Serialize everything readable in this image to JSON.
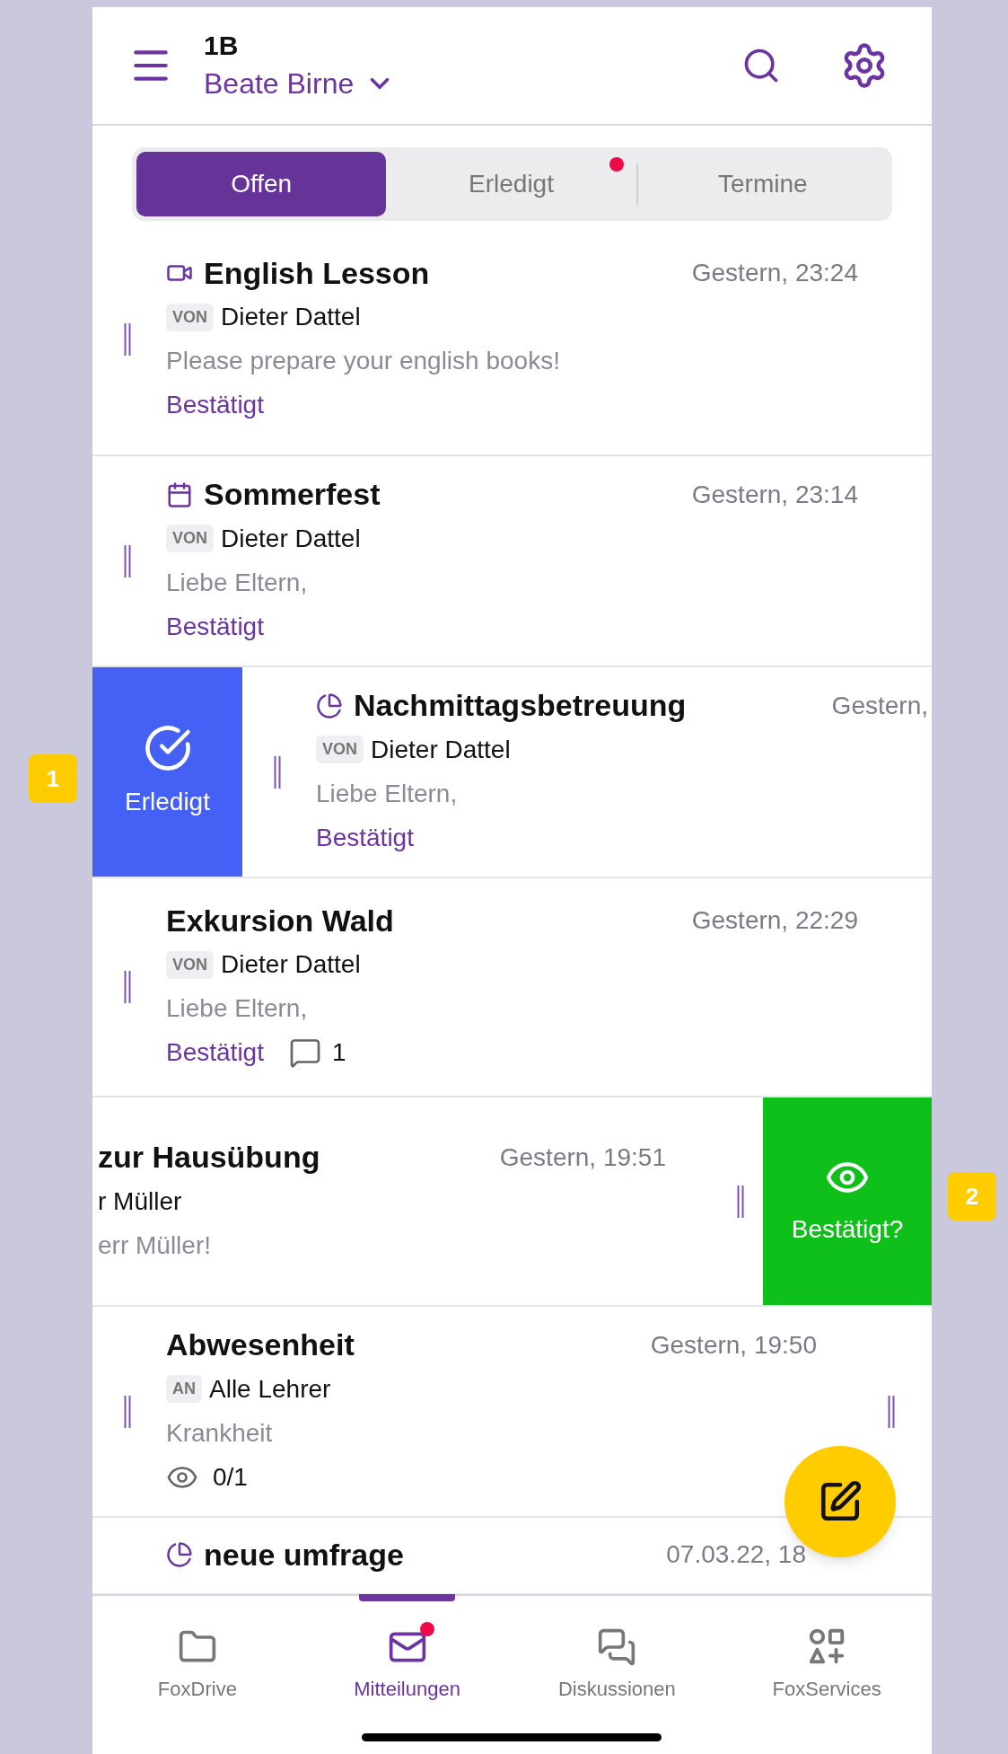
{
  "header": {
    "class_name": "1B",
    "user": "Beate Birne"
  },
  "tabs": [
    {
      "label": "Offen",
      "selected": true,
      "dot": false
    },
    {
      "label": "Erledigt",
      "selected": false,
      "dot": true
    },
    {
      "label": "Termine",
      "selected": false,
      "dot": false
    }
  ],
  "messages": [
    {
      "kind": "video",
      "title": "English Lesson",
      "time": "Gestern, 23:24",
      "tag": "VON",
      "person": "Dieter Dattel",
      "preview": "Please prepare your english books!",
      "status": "Bestätigt",
      "right_handle": false
    },
    {
      "kind": "calendar",
      "title": "Sommerfest",
      "time": "Gestern, 23:14",
      "tag": "VON",
      "person": "Dieter Dattel",
      "preview": "Liebe Eltern,",
      "status": "Bestätigt",
      "right_handle": false
    },
    {
      "kind": "poll",
      "title": "Nachmittagsbetreuung",
      "time": "Gestern,",
      "tag": "VON",
      "person": "Dieter Dattel",
      "preview": "Liebe Eltern,",
      "status": "Bestätigt",
      "action": {
        "kind": "done",
        "label": "Erledigt"
      },
      "right_handle": false
    },
    {
      "kind": "plain",
      "title": "Exkursion Wald",
      "time": "Gestern, 22:29",
      "tag": "VON",
      "person": "Dieter Dattel",
      "preview": "Liebe Eltern,",
      "status": "Bestätigt",
      "comments": "1",
      "right_handle": false
    },
    {
      "kind": "plain",
      "title": "zur Hausübung",
      "time": "Gestern, 19:51",
      "person": "r Müller",
      "preview": "err Müller!",
      "action": {
        "kind": "confirm",
        "label": "Bestätigt?"
      },
      "right_handle": true
    },
    {
      "kind": "plain",
      "title": "Abwesenheit",
      "time": "Gestern, 19:50",
      "tag": "AN",
      "person": "Alle Lehrer",
      "preview": "Krankheit",
      "seen": "0/1",
      "right_handle": true
    },
    {
      "kind": "poll",
      "title": "neue umfrage",
      "time": "07.03.22, 18",
      "right_handle": false
    }
  ],
  "nav": [
    {
      "kind": "folder",
      "label": "FoxDrive",
      "selected": false,
      "dot": false
    },
    {
      "kind": "mail",
      "label": "Mitteilungen",
      "selected": true,
      "dot": true
    },
    {
      "kind": "chat",
      "label": "Diskussionen",
      "selected": false,
      "dot": false
    },
    {
      "kind": "services",
      "label": "FoxServices",
      "selected": false,
      "dot": false
    }
  ],
  "annotations": [
    {
      "label": "1"
    },
    {
      "label": "2"
    }
  ]
}
